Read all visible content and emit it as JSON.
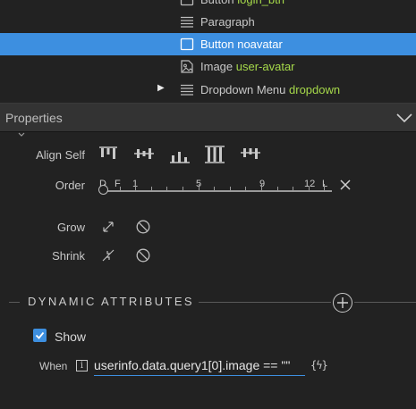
{
  "tree": {
    "items": [
      {
        "type": "Button",
        "name": "login_btn",
        "icon": "button-icon"
      },
      {
        "type": "Paragraph",
        "name": "",
        "icon": "paragraph-icon"
      },
      {
        "type": "Button",
        "name": "noavatar",
        "icon": "button-icon",
        "selected": true
      },
      {
        "type": "Image",
        "name": "user-avatar",
        "icon": "image-icon"
      },
      {
        "type": "Dropdown Menu",
        "name": "dropdown",
        "icon": "paragraph-icon",
        "expandable": true
      }
    ]
  },
  "properties": {
    "title": "Properties",
    "align_self": {
      "label": "Align Self"
    },
    "order": {
      "label": "Order",
      "tick_labels": [
        "D",
        "F",
        "1",
        "5",
        "9",
        "12",
        "L"
      ],
      "value": "D"
    },
    "grow": {
      "label": "Grow"
    },
    "shrink": {
      "label": "Shrink"
    }
  },
  "dynamic_attributes": {
    "title": "DYNAMIC ATTRIBUTES",
    "show": {
      "label": "Show",
      "checked": true
    },
    "when": {
      "label": "When",
      "info": "i",
      "expression": "userinfo.data.query1[0].image == \"\"",
      "bind_label": "{ϟ}"
    }
  },
  "colors": {
    "accent": "#3d8fe0",
    "name_green": "#a6d94a",
    "background": "#222222",
    "header": "#333333"
  }
}
